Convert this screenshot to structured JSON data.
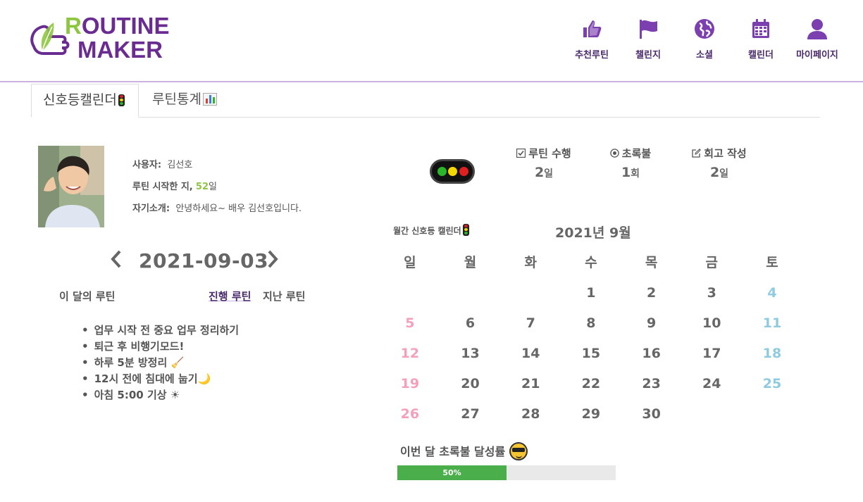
{
  "brand": {
    "line1_first": "R",
    "line1_rest": "OUTINE",
    "line2": "MAKER"
  },
  "nav": [
    {
      "label": "추천루틴",
      "icon": "thumbs-up-icon"
    },
    {
      "label": "챌린지",
      "icon": "flag-icon"
    },
    {
      "label": "소셜",
      "icon": "globe-icon"
    },
    {
      "label": "캘린더",
      "icon": "calendar-icon"
    },
    {
      "label": "마이페이지",
      "icon": "user-icon"
    }
  ],
  "tabs": [
    {
      "label": "신호등캘린더",
      "icon": "traffic-light-icon",
      "active": true
    },
    {
      "label": "루틴통계",
      "icon": "bar-chart-icon",
      "active": false
    }
  ],
  "profile": {
    "user_label": "사용자:",
    "user_name": "김선호",
    "start_label": "루틴 시작한 지,",
    "start_days": "52",
    "start_unit": "일",
    "intro_label": "자기소개:",
    "intro_text": "안녕하세요~ 배우 김선호입니다."
  },
  "date_nav": {
    "date": "2021-09-03",
    "prev": "‹",
    "next": "›"
  },
  "routine_tabs": {
    "month": "이 달의 루틴",
    "current": "진행 루틴",
    "past": "지난 루틴"
  },
  "routines": [
    "업무 시작 전 중요 업무 정리하기",
    "퇴근 후 비행기모드!",
    "하루 5분 방정리 🧹",
    "12시 전에 침대에 눕기🌙",
    "아침 5:00 기상 ☀"
  ],
  "stats": [
    {
      "label": "루틴 수행",
      "icon": "checkbox-icon",
      "value": "2",
      "unit": "일"
    },
    {
      "label": "초록불",
      "icon": "radio-dot-icon",
      "value": "1",
      "unit": "회"
    },
    {
      "label": "회고 작성",
      "icon": "edit-icon",
      "value": "2",
      "unit": "일"
    }
  ],
  "calendar": {
    "caption": "월간 신호등 캘린더",
    "month_title": "2021년 9월",
    "weekdays": [
      "일",
      "월",
      "화",
      "수",
      "목",
      "금",
      "토"
    ],
    "weeks": [
      [
        "",
        "",
        "",
        "1",
        "2",
        "3",
        "4"
      ],
      [
        "5",
        "6",
        "7",
        "8",
        "9",
        "10",
        "11"
      ],
      [
        "12",
        "13",
        "14",
        "15",
        "16",
        "17",
        "18"
      ],
      [
        "19",
        "20",
        "21",
        "22",
        "23",
        "24",
        "25"
      ],
      [
        "26",
        "27",
        "28",
        "29",
        "30",
        "",
        ""
      ]
    ],
    "sunday_color": "#f4a0bc",
    "saturday_color": "#8fcbe0"
  },
  "achievement": {
    "label": "이번 달 초록불 달성률",
    "percent": 50,
    "percent_text": "50%",
    "bar_color": "#4aae4a"
  },
  "colors": {
    "brand_purple": "#6a2c91",
    "brand_green": "#8dc63f",
    "nav_icon": "#7b3fb0"
  }
}
